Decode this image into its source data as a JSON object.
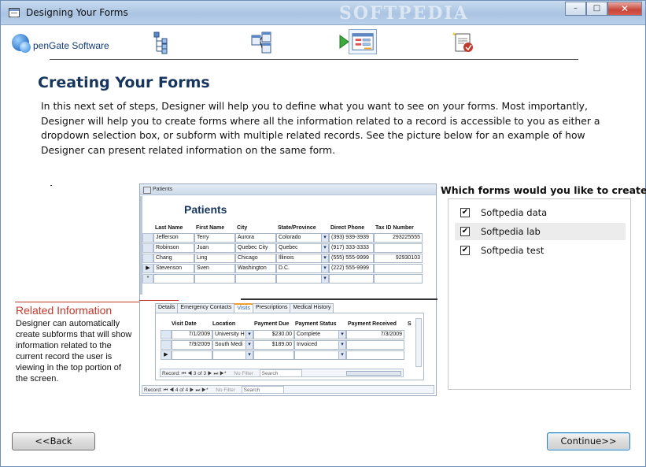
{
  "window": {
    "title": "Designing Your Forms",
    "watermark": "SOFTPEDIA",
    "controls": {
      "minimize": "–",
      "maximize": "□",
      "close": "✕"
    }
  },
  "brand": {
    "name": "penGate Software"
  },
  "steps": [
    {
      "icon": "hierarchy-icon"
    },
    {
      "icon": "related-tables-icon"
    },
    {
      "icon": "form-design-icon",
      "active": true
    },
    {
      "icon": "finish-report-icon"
    }
  ],
  "heading": "Creating Your Forms",
  "intro": "In this next set of steps, Designer will help you to define what you want to see on your forms.  Most importantly, Designer will help you to create forms where all the information related to a record is accessible to you as either a dropdown selection box, or subform with multiple related records.  See the picture below for  an example of how Designer can present related information on the same form.",
  "example": {
    "window_title": "Patients",
    "form_title": "Patients",
    "columns": [
      "Last Name",
      "First Name",
      "City",
      "State/Province",
      "Direct Phone",
      "Tax ID Number"
    ],
    "rows": [
      {
        "sel": "",
        "last": "Jefferson",
        "first": "Terry",
        "city": "Aurora",
        "state": "Colorado",
        "phone": "(393) 939-3939",
        "tax": "293225555"
      },
      {
        "sel": "",
        "last": "Robinson",
        "first": "Juan",
        "city": "Quebec City",
        "state": "Quebec",
        "phone": "(917) 333-3333",
        "tax": ""
      },
      {
        "sel": "",
        "last": "Chang",
        "first": "Ling",
        "city": "Chicago",
        "state": "Illinois",
        "phone": "(555) 555-9999",
        "tax": "92930103"
      },
      {
        "sel": "▶",
        "last": "Stevenson",
        "first": "Sven",
        "city": "Washington",
        "state": "D.C.",
        "phone": "(222) 555-9999",
        "tax": ""
      },
      {
        "sel": "*",
        "last": "",
        "first": "",
        "city": "",
        "state": "",
        "phone": "",
        "tax": ""
      }
    ],
    "tabs": [
      "Details",
      "Emergency Contacts",
      "Visits",
      "Prescriptions",
      "Medical History"
    ],
    "active_tab": "Visits",
    "sub_columns": [
      "Visit Date",
      "Location",
      "Payment Due",
      "Payment Status",
      "Payment Received",
      "S"
    ],
    "sub_rows": [
      {
        "sel": "",
        "date": "7/1/2009",
        "loc": "University H",
        "due": "$230.00",
        "status": "Complete",
        "recv": "7/3/2009"
      },
      {
        "sel": "",
        "date": "7/9/2009",
        "loc": "South Medi",
        "due": "$189.00",
        "status": "Invoiced",
        "recv": ""
      },
      {
        "sel": "▶",
        "date": "",
        "loc": "",
        "due": "",
        "status": "",
        "recv": ""
      }
    ],
    "sub_record_nav": "Record: ⏮ ◀ 3 of 3 ▶ ⏭ ▶*",
    "sub_no_filter": "No Filter",
    "sub_search": "Search",
    "main_record_nav": "Record: ⏮ ◀ 4 of 4 ▶ ⏭ ▶*",
    "main_no_filter": "No Filter",
    "main_search": "Search"
  },
  "callout": {
    "title": "Related Information",
    "text": "Designer can automatically create subforms that will show information related to the current record the user is viewing in the top portion of the screen."
  },
  "picker": {
    "title": "Which forms would you like to create?",
    "items": [
      {
        "label": "Softpedia data",
        "checked": true
      },
      {
        "label": "Softpedia lab",
        "checked": true
      },
      {
        "label": "Softpedia test",
        "checked": true
      }
    ],
    "check_glyph": "✔"
  },
  "buttons": {
    "back": "<<Back",
    "continue": "Continue>>"
  }
}
